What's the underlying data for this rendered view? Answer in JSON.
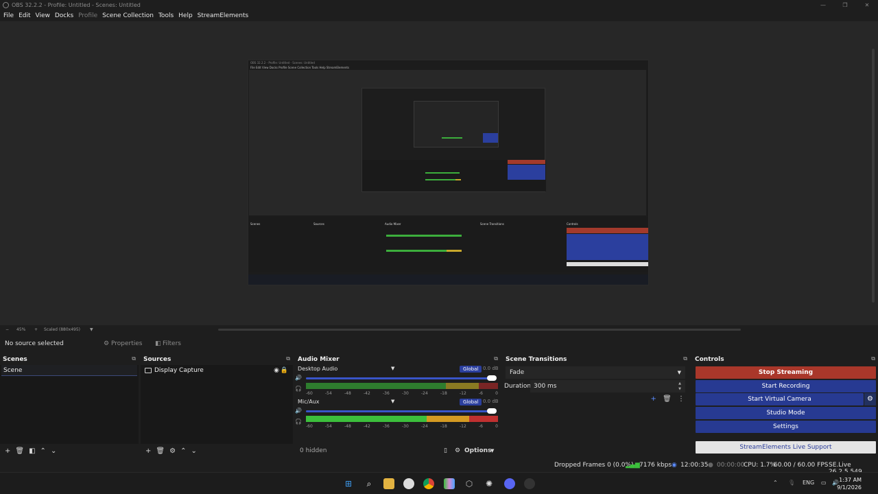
{
  "window": {
    "title": "OBS 32.2.2 - Profile: Untitled - Scenes: Untitled",
    "minimize": "—",
    "maximize": "❐",
    "close": "✕"
  },
  "menu": [
    "File",
    "Edit",
    "View",
    "Docks",
    "Profile",
    "Scene Collection",
    "Tools",
    "Help",
    "StreamElements"
  ],
  "preview_frame": {
    "title": "OBS 32.2.2 - Profile: Untitled - Scenes: Untitled",
    "menu": "File  Edit  View  Docks  Profile  Scene Collection  Tools  Help  StreamElements",
    "docks": [
      "Scenes",
      "Sources",
      "Audio Mixer",
      "Scene Transitions",
      "Controls"
    ],
    "stop_label": "Stop Streaming"
  },
  "zoom": {
    "minus": "−",
    "value": "45%",
    "plus": "+",
    "mode": "Scaled (880x495)",
    "arrow": "▼"
  },
  "source_toolbar": {
    "no_source": "No source selected",
    "properties": "Properties",
    "filters": "Filters"
  },
  "scenes": {
    "title": "Scenes",
    "items": [
      "Scene"
    ]
  },
  "sources": {
    "title": "Sources",
    "items": [
      "Display Capture"
    ]
  },
  "audio_mixer": {
    "title": "Audio Mixer",
    "channels": [
      {
        "name": "Desktop Audio",
        "global": "Global",
        "db": "0.0 dB",
        "volume": 0.98,
        "level": 0.0
      },
      {
        "name": "Mic/Aux",
        "global": "Global",
        "db": "0.0 dB",
        "volume": 0.98,
        "level": 0.85
      }
    ],
    "scale": [
      "-60",
      "-54",
      "-48",
      "-42",
      "-36",
      "-30",
      "-24",
      "-18",
      "-12",
      "-6",
      "0"
    ],
    "hidden": "0 hidden",
    "options": "Options"
  },
  "scene_transitions": {
    "title": "Scene Transitions",
    "selected": "Fade",
    "duration_label": "Duration",
    "duration_value": "300 ms"
  },
  "controls": {
    "title": "Controls",
    "stop_streaming": "Stop Streaming",
    "start_recording": "Start Recording",
    "start_virtual_camera": "Start Virtual Camera",
    "studio_mode": "Studio Mode",
    "settings": "Settings",
    "support": "StreamElements Live Support",
    "colors": {
      "stop": "#a9372a",
      "normal": "#273a92",
      "support": "#e4e4e4"
    }
  },
  "status": {
    "dropped_frames": "Dropped Frames 0 (0.0%)",
    "kbps": "7176 kbps",
    "stream_time": "12:00:35",
    "rec_time": "00:00:00",
    "cpu": "CPU: 1.7%",
    "fps": "60.00 / 60.00 FPS",
    "se_version": "SE.Live 26.2.5.549"
  },
  "taskbar": {
    "lang": "ENG",
    "time": "1:37 AM",
    "date": "9/1/2026",
    "icons": [
      "windows-start",
      "search",
      "file-explorer",
      "app",
      "chrome",
      "app",
      "app",
      "chatgpt",
      "discord",
      "obs"
    ]
  }
}
